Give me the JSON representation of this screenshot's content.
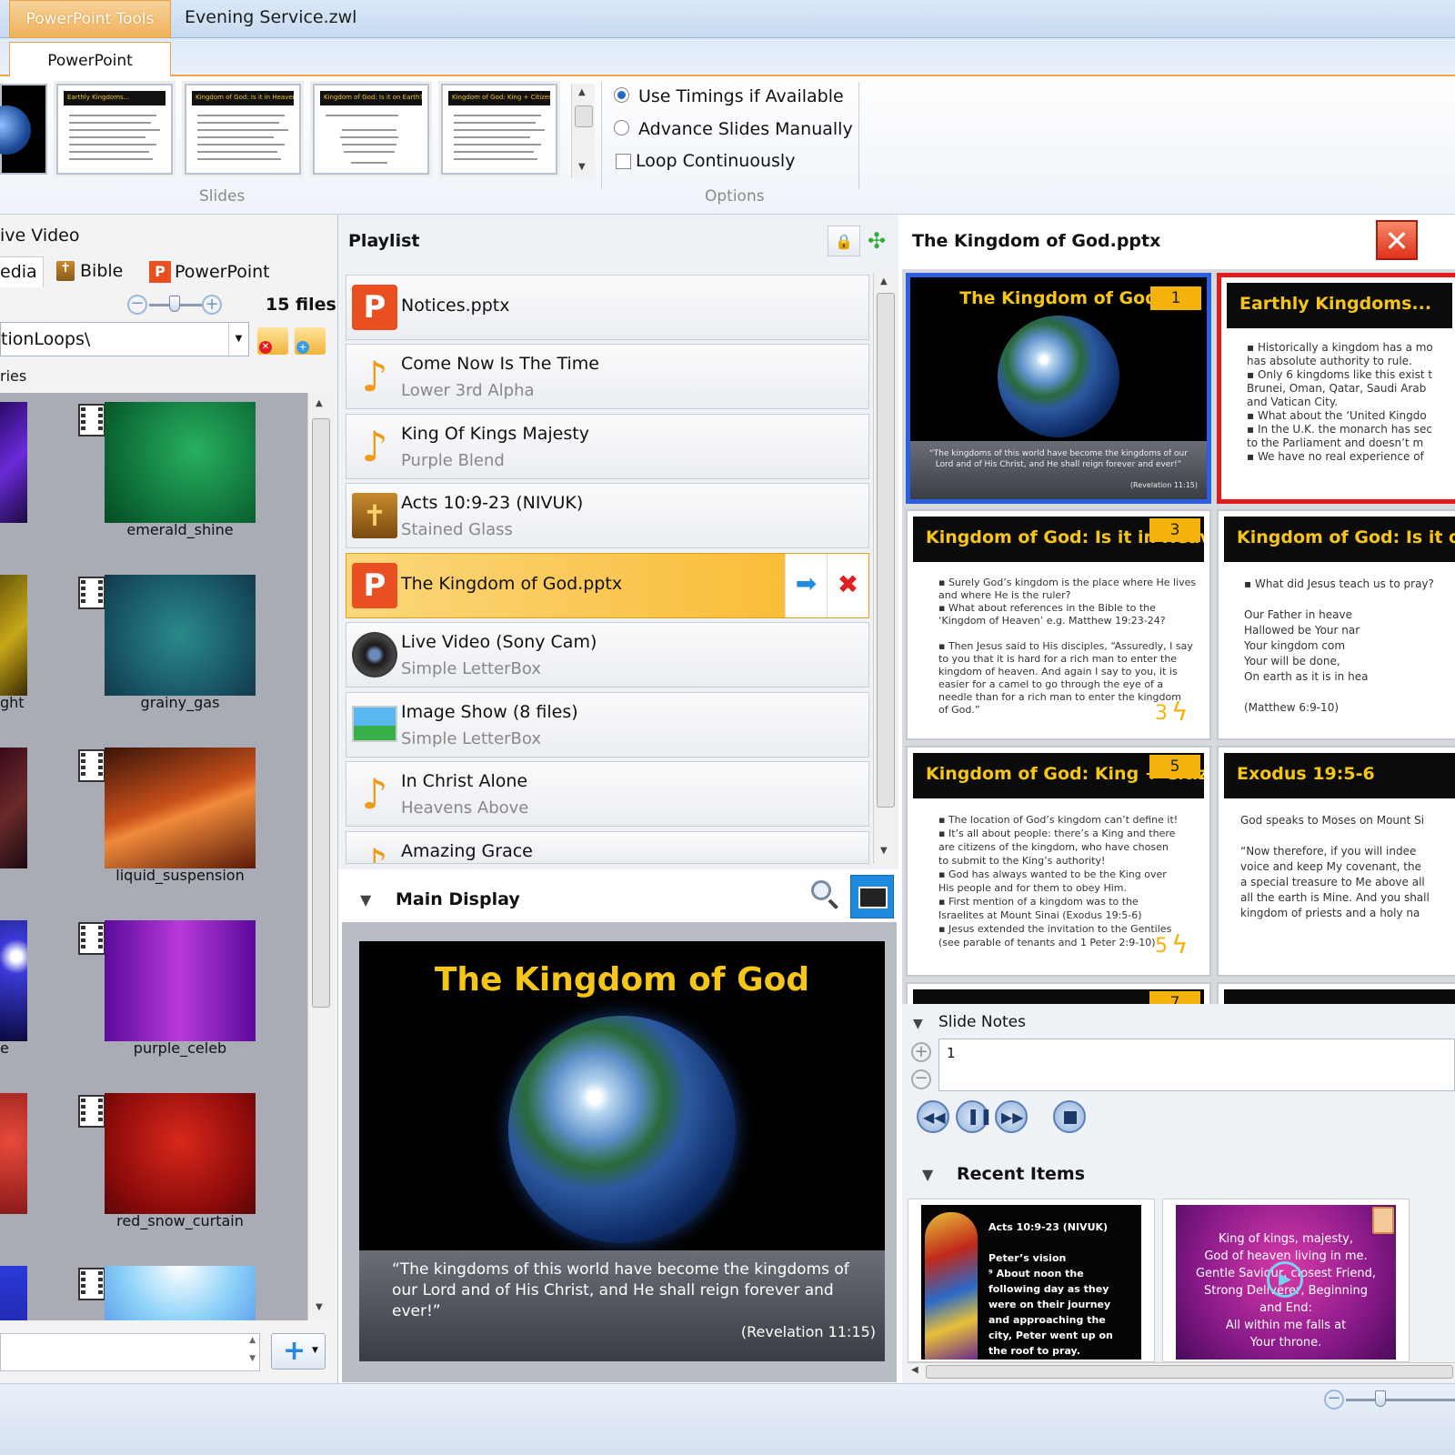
{
  "titlebar": {
    "context_tab": "PowerPoint Tools",
    "document_title": "Evening Service.zwl"
  },
  "ribbon": {
    "tab": "PowerPoint",
    "slides_group_label": "Slides",
    "options_group_label": "Options",
    "thumbnails": [
      {
        "title": "Earthly Kingdoms..."
      },
      {
        "title": "Kingdom of God: Is it in Heaven?"
      },
      {
        "title": "Kingdom of God: Is it on Earth?"
      },
      {
        "title": "Kingdom of God: King + Citizens"
      }
    ],
    "options": {
      "use_timings": "Use Timings if Available",
      "advance_manually": "Advance Slides Manually",
      "loop": "Loop Continuously"
    }
  },
  "left": {
    "live_video_label": "ive Video",
    "tabs": {
      "media": "edia",
      "bible": "Bible",
      "powerpoint": "PowerPoint"
    },
    "file_count": "15 files",
    "path": "tionLoops\\",
    "category_label": "ries",
    "media_items": [
      {
        "name": "emerald_shine",
        "left_name": ""
      },
      {
        "name": "grainy_gas",
        "left_name": "ght"
      },
      {
        "name": "liquid_suspension",
        "left_name": ""
      },
      {
        "name": "purple_celeb",
        "left_name": "e"
      },
      {
        "name": "red_snow_curtain",
        "left_name": ""
      },
      {
        "name": "",
        "left_name": ""
      }
    ]
  },
  "playlist": {
    "title": "Playlist",
    "items": [
      {
        "title": "Notices.pptx",
        "subtitle": "",
        "icon": "powerpoint-icon"
      },
      {
        "title": "Come Now Is The Time",
        "subtitle": "Lower 3rd Alpha",
        "icon": "music-note-icon"
      },
      {
        "title": "King Of Kings Majesty",
        "subtitle": "Purple Blend",
        "icon": "music-note-icon"
      },
      {
        "title": "Acts 10:9-23 (NIVUK)",
        "subtitle": "Stained Glass",
        "icon": "bible-icon"
      },
      {
        "title": "The Kingdom of God.pptx",
        "subtitle": "",
        "icon": "powerpoint-icon",
        "selected": true
      },
      {
        "title": "Live Video (Sony Cam)",
        "subtitle": "Simple LetterBox",
        "icon": "camera-icon"
      },
      {
        "title": "Image Show (8 files)",
        "subtitle": "Simple LetterBox",
        "icon": "image-icon"
      },
      {
        "title": "In Christ Alone",
        "subtitle": "Heavens Above",
        "icon": "music-note-icon"
      },
      {
        "title": "Amazing Grace",
        "subtitle": "",
        "icon": "music-note-icon"
      }
    ]
  },
  "main_display": {
    "title": "Main Display",
    "slide_title": "The Kingdom of God",
    "quote": "“The kingdoms of this world have become the kingdoms of our Lord and of His Christ, and He shall reign forever and ever!”",
    "reference": "(Revelation 11:15)"
  },
  "presentation": {
    "title": "The Kingdom of God.pptx",
    "slides": [
      {
        "num": "1",
        "title": "The Kingdom of God",
        "body": "“The kingdoms of this world have become the kingdoms of our Lord and of His Christ, and He shall reign forever and ever!”",
        "ref": "(Revelation 11:15)"
      },
      {
        "num": "",
        "title": "Earthly Kingdoms...",
        "body": "▪ Historically a kingdom has a mo\n   has absolute authority to rule.\n▪ Only 6 kingdoms like this exist t\n   Brunei, Oman, Qatar, Saudi Arab\n   and Vatican City.\n▪ What about the ‘United Kingdo\n▪ In the U.K. the monarch has sec\n   to the Parliament and doesn’t m\n▪ We have no real experience of"
      },
      {
        "num": "3",
        "title": "Kingdom of God:  Is it in Heaven?",
        "body": "▪ Surely God’s kingdom is the place where He lives\n   and where He is the ruler?\n▪ What about references in the Bible to the\n   ‘Kingdom of Heaven’ e.g. Matthew 19:23-24?\n\n▪ Then Jesus said to His disciples, “Assuredly, I say\n   to you that it is hard for a rich man to enter the\n   kingdom of heaven. And again I say to you, it is\n   easier for a camel to go through the eye of a\n   needle than for a rich man to enter the kingdom\n   of God.”"
      },
      {
        "num": "",
        "title": "Kingdom of God:  Is it o",
        "body": "▪ What did Jesus teach us to pray?\n\n          Our Father in heave\n        Hallowed be Your nar\n          Your kingdom com\n            Your will be done,\n       On earth as it is in hea\n\n            (Matthew 6:9-10)"
      },
      {
        "num": "5",
        "title": "Kingdom of God: King + Citizens",
        "body": "▪ The location of God’s kingdom can’t define it!\n▪ It’s all about people: there’s a King and there\n   are citizens of the kingdom, who have chosen\n   to submit to the King’s authority!\n▪ God has always wanted to be the King over\n   His people and for them to obey Him.\n▪ First mention of a kingdom was to the\n   Israelites at Mount Sinai (Exodus 19:5-6)\n▪ Jesus extended the invitation to the Gentiles\n   (see parable of tenants and 1 Peter 2:9-10)"
      },
      {
        "num": "",
        "title": "Exodus 19:5-6",
        "body": "God speaks to Moses on Mount Si\n\n“Now therefore, if you will indee\nvoice and keep My covenant, the\na special treasure to Me above all\nall the earth is Mine. And you shall\nkingdom of priests and a holy na"
      }
    ],
    "badge_3": "3",
    "badge_5": "5",
    "partial_num": "7"
  },
  "notes": {
    "title": "Slide Notes",
    "value": "1"
  },
  "recent": {
    "title": "Recent Items",
    "card1": "Acts 10:9-23 (NIVUK)\n\nPeter’s vision\n⁹ About noon the\nfollowing day as they\nwere on their journey\nand approaching the\ncity, Peter went up on\nthe roof to pray.",
    "card2": "King of kings, majesty,\nGod of heaven living in me.\nGentle Saviour, closest Friend,\nStrong Deliverer, Beginning\nand End:\nAll within me falls at\nYour throne."
  },
  "colors": {
    "accent_orange": "#f0a149",
    "selected_blue": "#2b5fe0",
    "live_red": "#e21b1b",
    "slide_gold": "#f5c518"
  }
}
